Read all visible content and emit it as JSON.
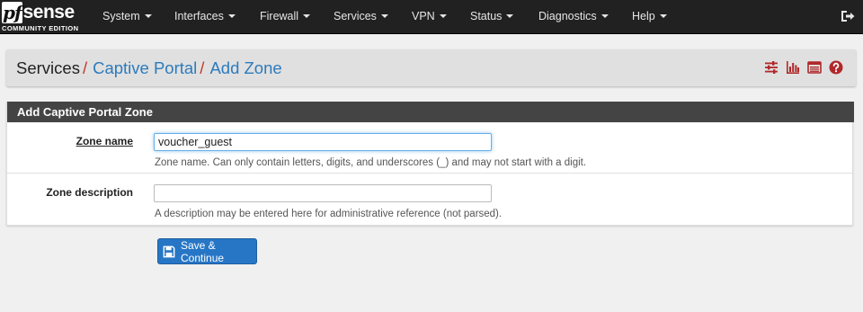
{
  "brand": {
    "logo_text": "pfsense",
    "edition": "COMMUNITY EDITION"
  },
  "nav": {
    "items": [
      {
        "label": "System"
      },
      {
        "label": "Interfaces"
      },
      {
        "label": "Firewall"
      },
      {
        "label": "Services"
      },
      {
        "label": "VPN"
      },
      {
        "label": "Status"
      },
      {
        "label": "Diagnostics"
      },
      {
        "label": "Help"
      }
    ],
    "logout_icon": "sign-out-icon"
  },
  "breadcrumb": {
    "items": [
      "Services",
      "Captive Portal",
      "Add Zone"
    ],
    "separator": "/"
  },
  "header_icons": [
    "sliders-icon",
    "bar-chart-icon",
    "log-list-icon",
    "help-question-icon"
  ],
  "panel": {
    "title": "Add Captive Portal Zone",
    "fields": [
      {
        "label": "Zone name",
        "value": "voucher_guest",
        "help": "Zone name. Can only contain letters, digits, and underscores (_) and may not start with a digit."
      },
      {
        "label": "Zone description",
        "value": "",
        "help": "A description may be entered here for administrative reference (not parsed)."
      }
    ]
  },
  "actions": {
    "save_label": "Save & Continue",
    "save_icon": "save-floppy-icon"
  },
  "colors": {
    "navbar_bg": "#212121",
    "panel_heading_bg": "#444444",
    "link": "#2c7bbd",
    "separator": "#c0392b",
    "icon_red": "#b0282a",
    "button_bg": "#2776c6"
  }
}
